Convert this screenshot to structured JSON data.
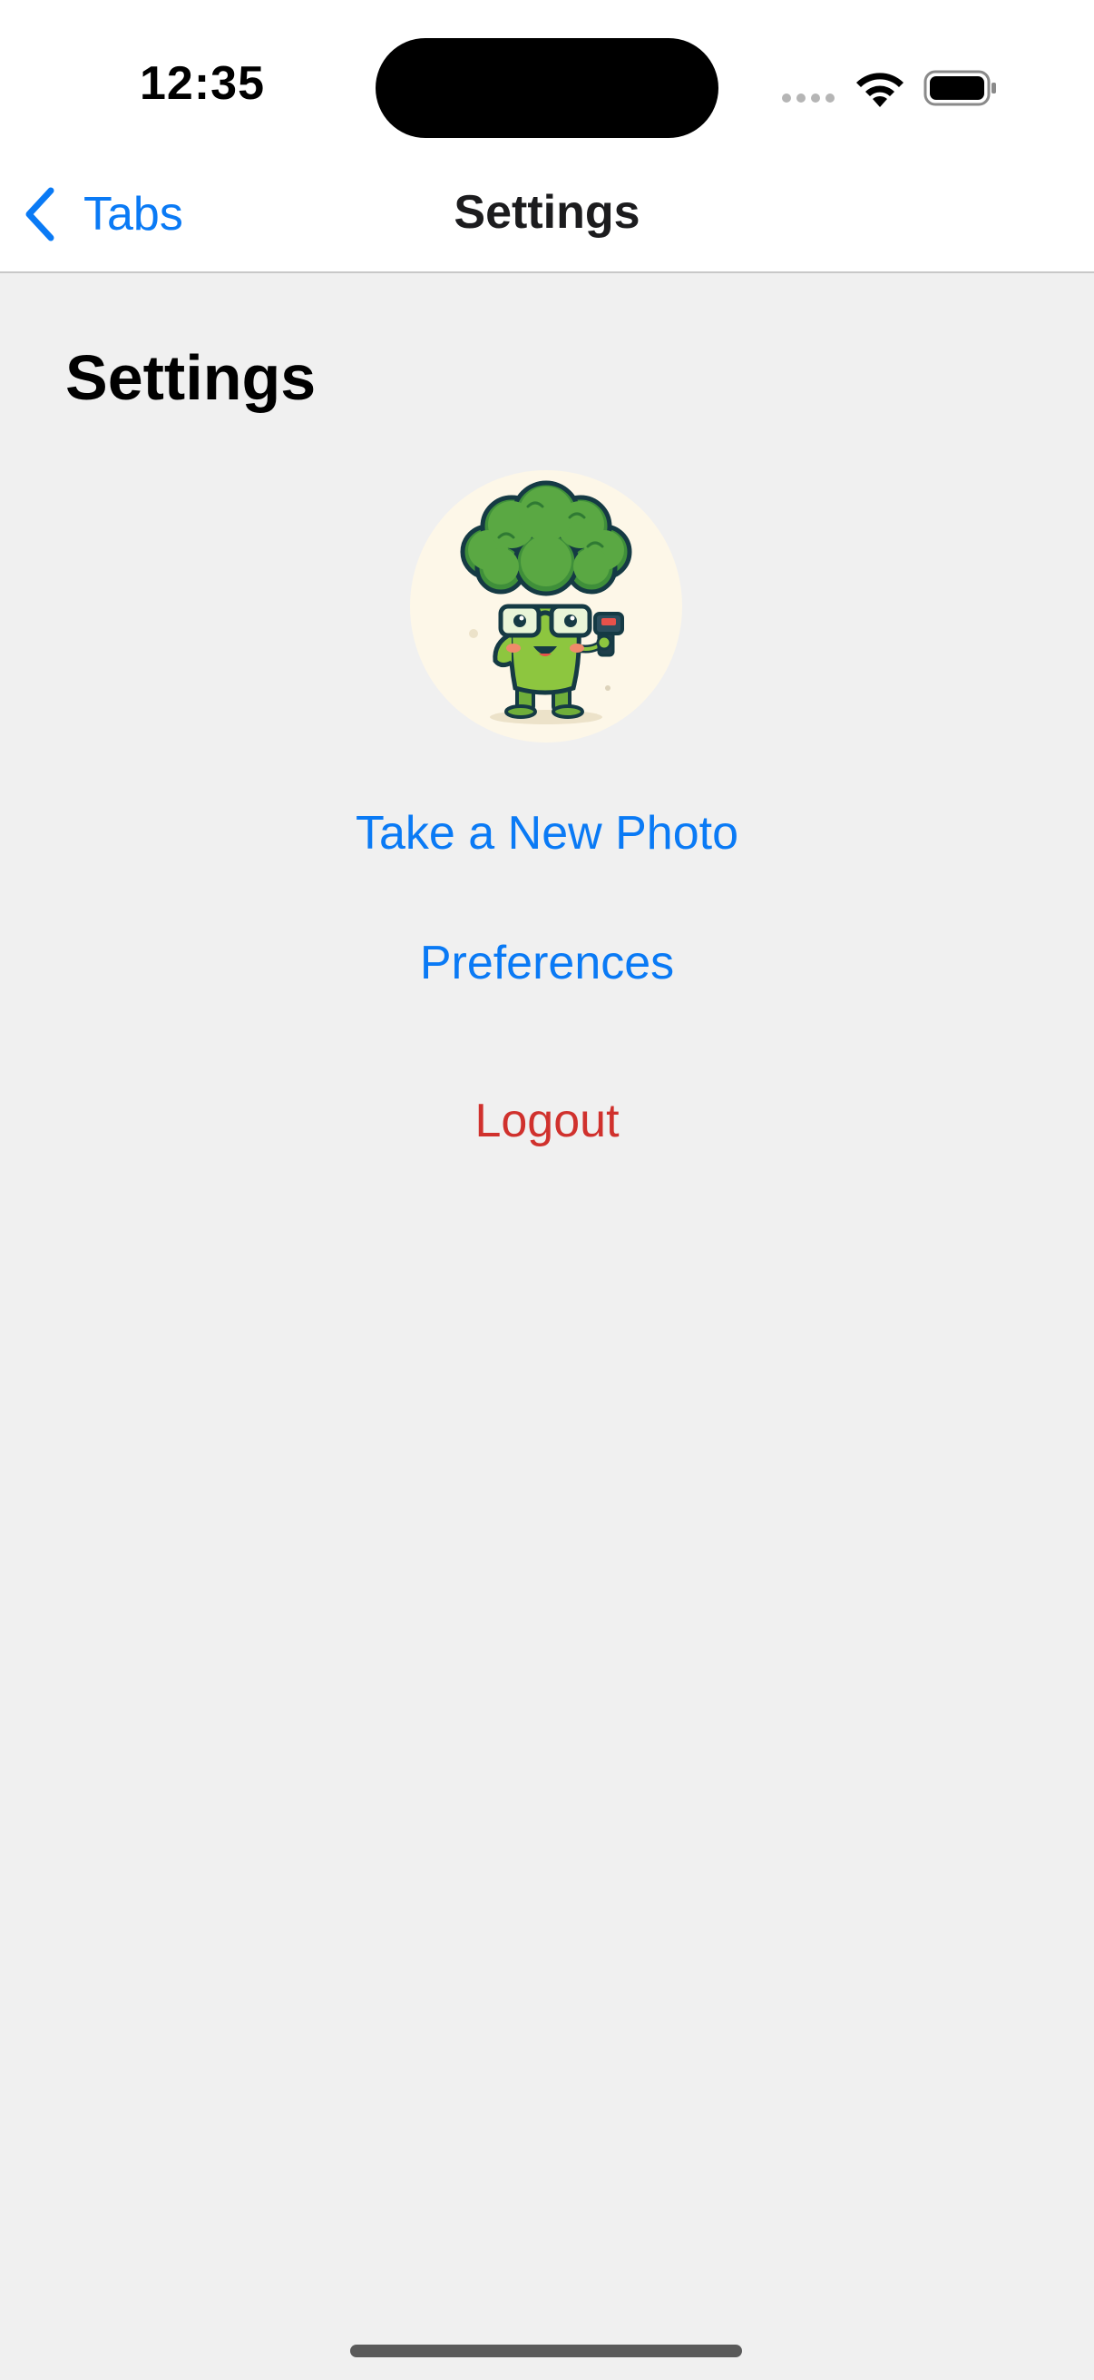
{
  "status_bar": {
    "time": "12:35"
  },
  "nav_bar": {
    "back_label": "Tabs",
    "title": "Settings",
    "accent_color": "#0a7af5"
  },
  "page": {
    "heading": "Settings",
    "avatar_icon": "broccoli-mascot-icon"
  },
  "actions": {
    "take_photo": "Take a New Photo",
    "preferences": "Preferences",
    "logout": "Logout",
    "logout_color": "#d0312d"
  }
}
